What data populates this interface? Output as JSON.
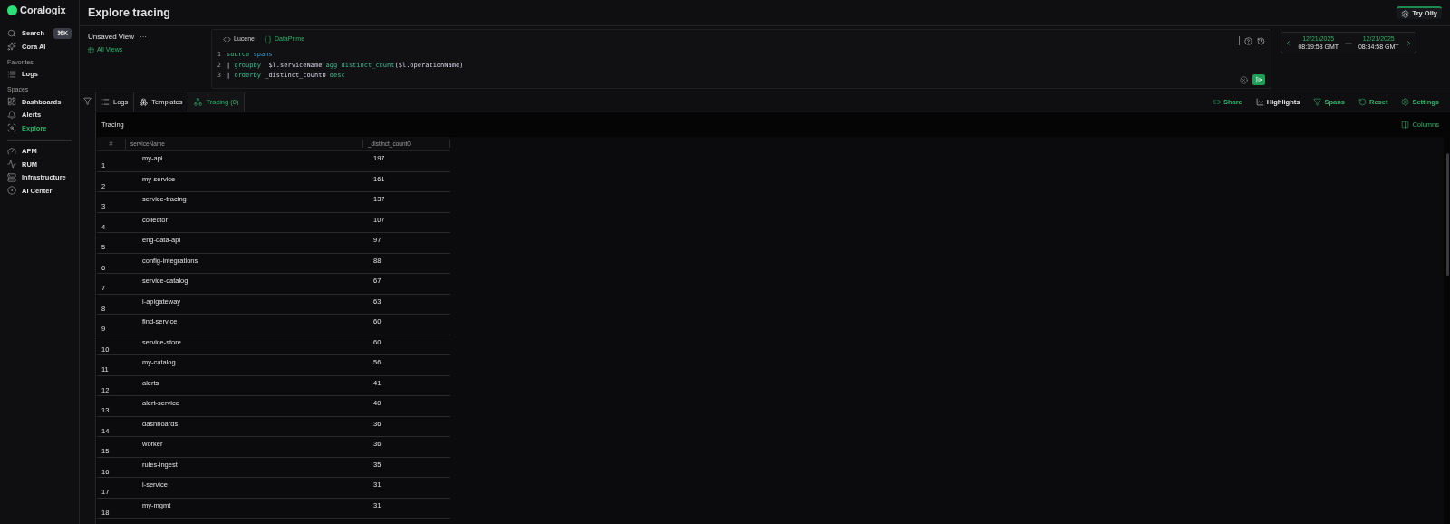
{
  "brand": "Coralogix",
  "page_title": "Explore tracing",
  "try_button": "Try Olly",
  "sidebar": {
    "search": {
      "label": "Search",
      "shortcut": "⌘K"
    },
    "top_items": [
      {
        "label": "Cora AI",
        "selected": false
      }
    ],
    "sections": [
      {
        "title": "Favorites",
        "items": [
          {
            "label": "Logs",
            "selected": false
          }
        ]
      },
      {
        "title": "Spaces",
        "items": [
          {
            "label": "Dashboards",
            "selected": false
          },
          {
            "label": "Alerts",
            "selected": false
          },
          {
            "label": "Explore",
            "selected": true
          }
        ]
      }
    ],
    "bottom_items": [
      {
        "label": "APM",
        "selected": false
      },
      {
        "label": "RUM",
        "selected": false
      },
      {
        "label": "Infrastructure",
        "selected": false
      },
      {
        "label": "AI Center",
        "selected": false
      }
    ]
  },
  "view": {
    "title": "Unsaved View",
    "menu": "···",
    "all_views": "All Views"
  },
  "query": {
    "modes": [
      {
        "label": "Lucene",
        "selected": false
      },
      {
        "label": "DataPrime",
        "selected": true
      }
    ],
    "lines": [
      {
        "number": "1",
        "tokens": [
          {
            "text": "source ",
            "kind": "keyword"
          },
          {
            "text": "spans",
            "kind": "value"
          }
        ]
      },
      {
        "number": "2",
        "tokens": [
          {
            "text": "| ",
            "kind": "plain"
          },
          {
            "text": "groupby",
            "kind": "keyword"
          },
          {
            "text": "  $l.serviceName ",
            "kind": "plain"
          },
          {
            "text": "agg ",
            "kind": "keyword"
          },
          {
            "text": "distinct_count",
            "kind": "keyword"
          },
          {
            "text": "($l.operationName)",
            "kind": "plain"
          }
        ]
      },
      {
        "number": "3",
        "tokens": [
          {
            "text": "| ",
            "kind": "plain"
          },
          {
            "text": "orderby",
            "kind": "keyword"
          },
          {
            "text": " _distinct_count0 ",
            "kind": "plain"
          },
          {
            "text": "desc",
            "kind": "keyword"
          }
        ]
      }
    ]
  },
  "time_range": {
    "from_date": "12/21/2025",
    "from_time": "08:19:58 GMT",
    "separator": "—",
    "to_date": "12/21/2025",
    "to_time": "08:34:58 GMT"
  },
  "tabs": [
    {
      "label": "Logs",
      "selected": false
    },
    {
      "label": "Templates",
      "selected": false
    },
    {
      "label": "Tracing (0)",
      "selected": true
    }
  ],
  "actions": [
    {
      "label": "Share",
      "color": "#2fb46a"
    },
    {
      "label": "Highlights",
      "color": "#e6e6e6"
    },
    {
      "label": "Spans",
      "color": "#2fb46a"
    },
    {
      "label": "Reset",
      "color": "#2fb46a"
    },
    {
      "label": "Settings",
      "color": "#2fb46a"
    }
  ],
  "table": {
    "title": "Tracing",
    "columns_button": "Columns",
    "columns": [
      "#",
      "serviceName",
      "_distinct_count0"
    ],
    "rows": [
      [
        "1",
        "my-api",
        "197"
      ],
      [
        "2",
        "my-service",
        "161"
      ],
      [
        "3",
        "service-tracing",
        "137"
      ],
      [
        "4",
        "collector",
        "107"
      ],
      [
        "5",
        "eng-data-api",
        "97"
      ],
      [
        "6",
        "config-integrations",
        "88"
      ],
      [
        "7",
        "service-catalog",
        "67"
      ],
      [
        "8",
        "i-apigateway",
        "63"
      ],
      [
        "9",
        "find-service",
        "60"
      ],
      [
        "10",
        "service-store",
        "60"
      ],
      [
        "11",
        "my-catalog",
        "56"
      ],
      [
        "12",
        "alerts",
        "41"
      ],
      [
        "13",
        "alert-service",
        "40"
      ],
      [
        "14",
        "dashboards",
        "36"
      ],
      [
        "15",
        "worker",
        "36"
      ],
      [
        "16",
        "rules-ingest",
        "35"
      ],
      [
        "17",
        "i-service",
        "31"
      ],
      [
        "18",
        "my-mgmt",
        "31"
      ]
    ]
  }
}
